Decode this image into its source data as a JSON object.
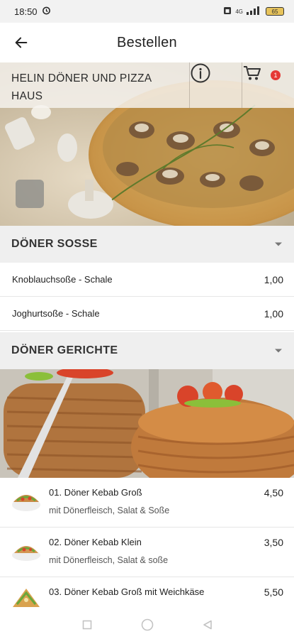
{
  "status_bar": {
    "time": "18:50",
    "network": "4G",
    "battery": "65"
  },
  "app_bar": {
    "title": "Bestellen"
  },
  "shop": {
    "name_line1": "HELIN DÖNER UND PIZZA",
    "name_line2": "HAUS",
    "cart_count": "1"
  },
  "categories": [
    {
      "title": "DÖNER SOSSE",
      "items": [
        {
          "name": "Knoblauchsoße - Schale",
          "price": "1,00"
        },
        {
          "name": "Joghurtsoße - Schale",
          "price": "1,00"
        }
      ]
    },
    {
      "title": "DÖNER GERICHTE",
      "items": [
        {
          "name": "01. Döner Kebab Groß",
          "description": "mit Dönerfleisch, Salat & Soße",
          "price": "4,50"
        },
        {
          "name": "02. Döner Kebab Klein",
          "description": "mit Dönerfleisch, Salat & soße",
          "price": "3,50"
        },
        {
          "name": "03. Döner Kebab Groß mit Weichkäse",
          "price": "5,50"
        }
      ]
    }
  ],
  "colors": {
    "accent_badge": "#e53935",
    "category_bg": "#efefef",
    "status_bg": "#f2f2f2"
  }
}
